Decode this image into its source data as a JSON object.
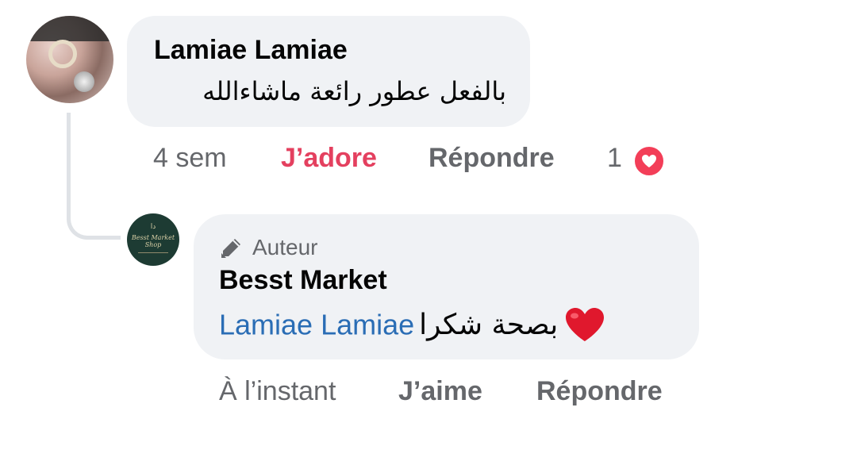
{
  "comment": {
    "author": "Lamiae Lamiae",
    "text": "بالفعل عطور رائعة ماشاءالله",
    "actions": {
      "time": "4 sem",
      "reaction_label": "J’adore",
      "reply_label": "Répondre"
    },
    "reaction_count": "1",
    "reaction_icon": "heart-reaction-icon",
    "reaction_color": "#f33e58",
    "reaction_label_color": "#e4405f"
  },
  "reply": {
    "badge_icon": "pen-icon",
    "badge_label": "Auteur",
    "author": "Besst Market",
    "mention": "Lamiae Lamiae",
    "text": "بصحة شكرا",
    "emoji": "red-heart-emoji",
    "mention_color": "#2a6db5",
    "avatar_logo": {
      "mark": "ﺩﺍ",
      "line1": "Besst Market",
      "line2": "Shop"
    },
    "actions": {
      "time": "À l’instant",
      "like_label": "J’aime",
      "reply_label": "Répondre"
    }
  },
  "colors": {
    "bubble_bg": "#f0f2f5",
    "secondary_text": "#65676b",
    "thread_line": "#dfe2e6"
  }
}
